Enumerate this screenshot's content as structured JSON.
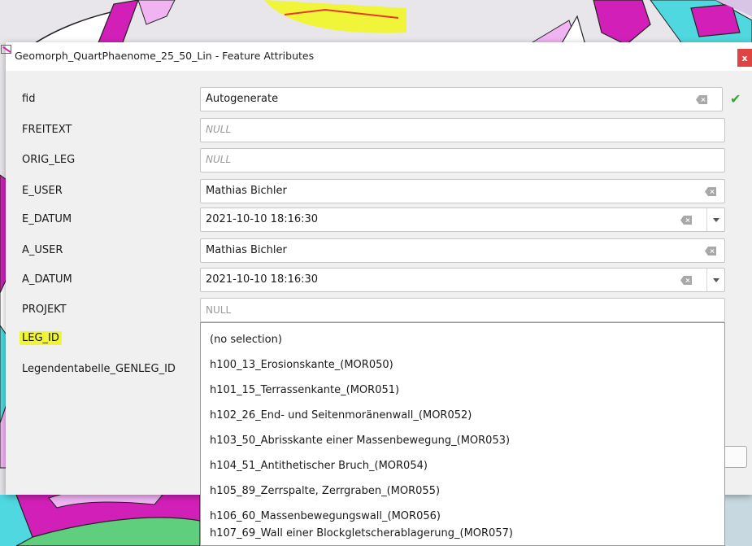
{
  "window": {
    "title": "Geomorph_QuartPhaenome_25_50_Lin - Feature Attributes",
    "close_label": "x"
  },
  "fields": [
    {
      "label": "fid",
      "value": "Autogenerate",
      "placeholder": ""
    },
    {
      "label": "FREITEXT",
      "value": "",
      "placeholder": "NULL"
    },
    {
      "label": "ORIG_LEG",
      "value": "",
      "placeholder": "NULL"
    },
    {
      "label": "E_USER",
      "value": "Mathias Bichler",
      "placeholder": ""
    },
    {
      "label": "E_DATUM",
      "value": "2021-10-10 18:16:30",
      "placeholder": ""
    },
    {
      "label": "A_USER",
      "value": "Mathias Bichler",
      "placeholder": ""
    },
    {
      "label": "A_DATUM",
      "value": "2021-10-10 18:16:30",
      "placeholder": ""
    },
    {
      "label": "PROJEKT",
      "value": "",
      "placeholder": "NULL"
    },
    {
      "label": "LEG_ID",
      "value": "",
      "placeholder": ""
    },
    {
      "label": "Legendentabelle_GENLEG_ID",
      "value": "",
      "placeholder": ""
    }
  ],
  "leg_id_options": [
    "(no selection)",
    "h100_13_Erosionskante_(MOR050)",
    "h101_15_Terrassenkante_(MOR051)",
    "h102_26_End- und Seitenmoränenwall_(MOR052)",
    "h103_50_Abrisskante einer Massenbewegung_(MOR053)",
    "h104_51_Antithetischer Bruch_(MOR054)",
    "h105_89_Zerrspalte, Zerrgraben_(MOR055)",
    "h106_60_Massenbewegungswall_(MOR056)",
    "h107_69_Wall einer Blockgletscherablagerung_(MOR057)"
  ],
  "icons": {
    "valid": "check-icon",
    "clear": "clear-icon",
    "dropdown": "chevron-down-icon",
    "app": "digitize-icon"
  },
  "colors": {
    "highlight": "#f1f53a",
    "valid_check": "#37a43a",
    "close_button": "#e04343",
    "map_magenta": "#d21fb8",
    "map_cyan": "#4fd8df",
    "map_pink": "#f0b4f2",
    "map_green": "#5fce7d"
  }
}
